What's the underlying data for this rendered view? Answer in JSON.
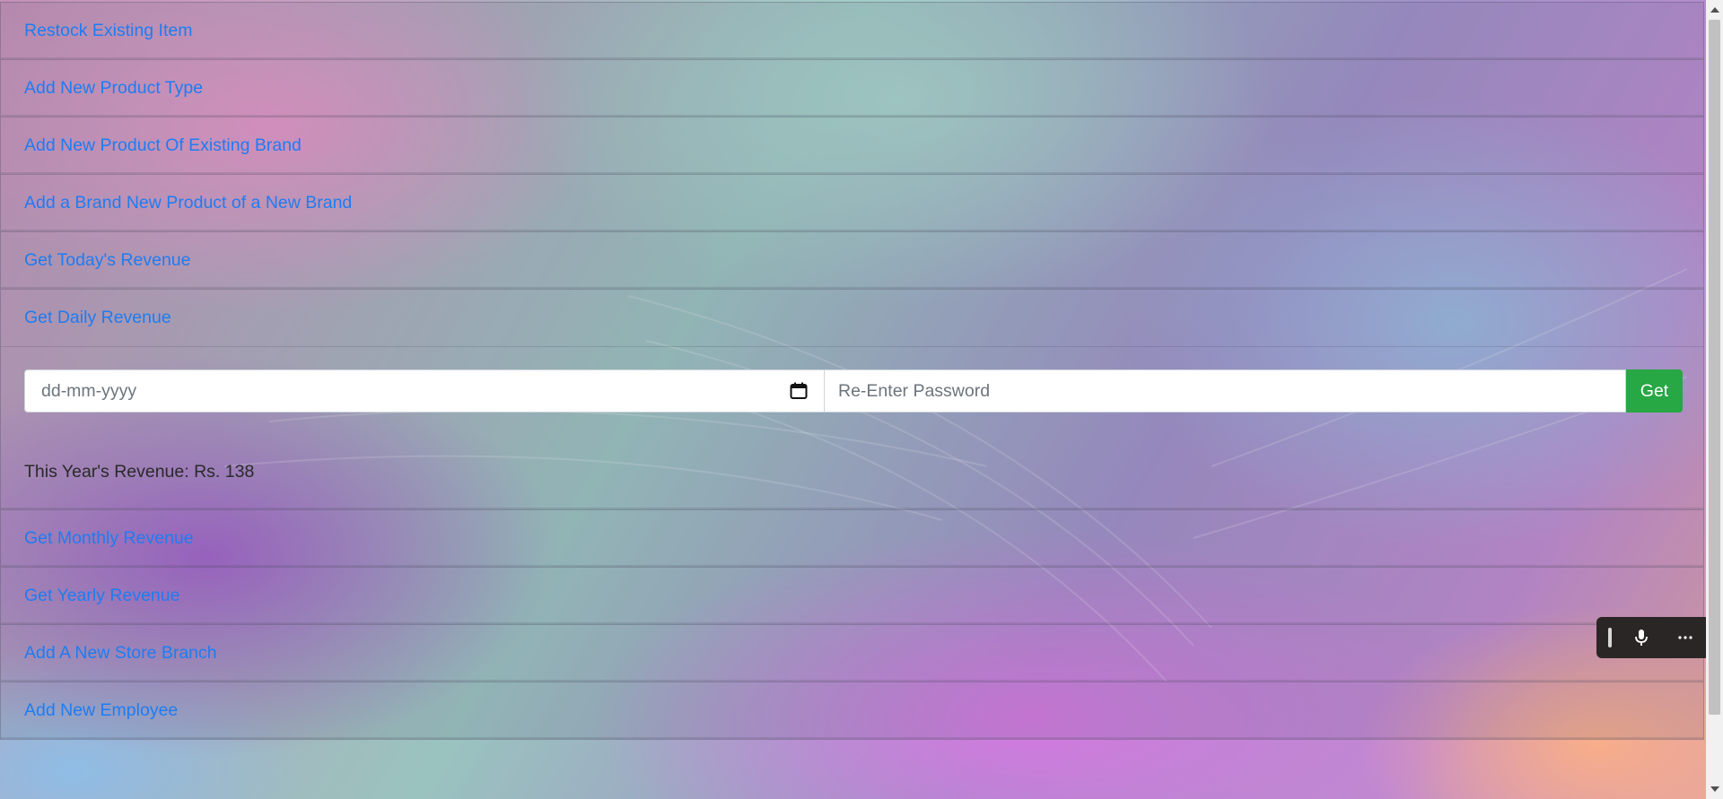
{
  "accordion": {
    "items": [
      {
        "label": "Restock Existing Item"
      },
      {
        "label": "Add New Product Type"
      },
      {
        "label": "Add New Product Of Existing Brand"
      },
      {
        "label": "Add a Brand New Product of a New Brand"
      },
      {
        "label": "Get Today's Revenue"
      },
      {
        "label": "Get Daily Revenue"
      },
      {
        "label": "Get Monthly Revenue"
      },
      {
        "label": "Get Yearly Revenue"
      },
      {
        "label": "Add A New Store Branch"
      },
      {
        "label": "Add New Employee"
      }
    ],
    "expanded": {
      "date_placeholder": "dd-mm-yyyy",
      "password_placeholder": "Re-Enter Password",
      "button_label": "Get",
      "result": "This Year's Revenue: Rs. 138"
    }
  },
  "icons": {
    "calendar": "calendar-icon",
    "microphone": "microphone-icon",
    "more": "more-options-icon"
  },
  "colors": {
    "link": "#1e7cf2",
    "success": "#28a745",
    "toolbar": "#2b2626"
  }
}
